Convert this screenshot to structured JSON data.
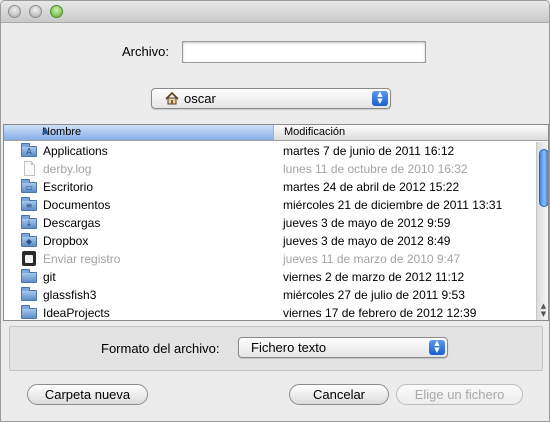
{
  "archivo": {
    "label": "Archivo:",
    "value": ""
  },
  "location": {
    "value": "oscar",
    "icon": "home-icon"
  },
  "table": {
    "col_name": "Nombre",
    "col_modified": "Modificación",
    "sorted_by": "Nombre",
    "rows": [
      {
        "name": "Applications",
        "modified": "martes 7 de junio de 2011 16:12",
        "icon": "folder-icon",
        "dim": false
      },
      {
        "name": "derby.log",
        "modified": "lunes 11 de octubre de 2010 16:32",
        "icon": "document-icon",
        "dim": true
      },
      {
        "name": "Escritorio",
        "modified": "martes 24 de abril de 2012 15:22",
        "icon": "folder-icon",
        "dim": false
      },
      {
        "name": "Documentos",
        "modified": "miércoles 21 de diciembre de 2011 13:31",
        "icon": "folder-icon",
        "dim": false
      },
      {
        "name": "Descargas",
        "modified": "jueves 3 de mayo de 2012 9:59",
        "icon": "folder-icon",
        "dim": false
      },
      {
        "name": "Dropbox",
        "modified": "jueves 3 de mayo de 2012 8:49",
        "icon": "folder-icon",
        "dim": false
      },
      {
        "name": "Enviar registro",
        "modified": "jueves 11 de marzo de 2010 9:47",
        "icon": "app-icon",
        "dim": true
      },
      {
        "name": "git",
        "modified": "viernes 2 de marzo de 2012 11:12",
        "icon": "folder-icon",
        "dim": false
      },
      {
        "name": "glassfish3",
        "modified": "miércoles 27 de julio de 2011 9:53",
        "icon": "folder-icon",
        "dim": false
      },
      {
        "name": "IdeaProjects",
        "modified": "viernes 17 de febrero de 2012 12:39",
        "icon": "folder-icon",
        "dim": false
      }
    ]
  },
  "format": {
    "label": "Formato del archivo:",
    "value": "Fichero texto"
  },
  "buttons": {
    "new_folder": "Carpeta nueva",
    "cancel": "Cancelar",
    "choose": "Elige un fichero"
  },
  "colors": {
    "selection_blue": "#1a5fcc",
    "header_blue": "#86aee6"
  }
}
